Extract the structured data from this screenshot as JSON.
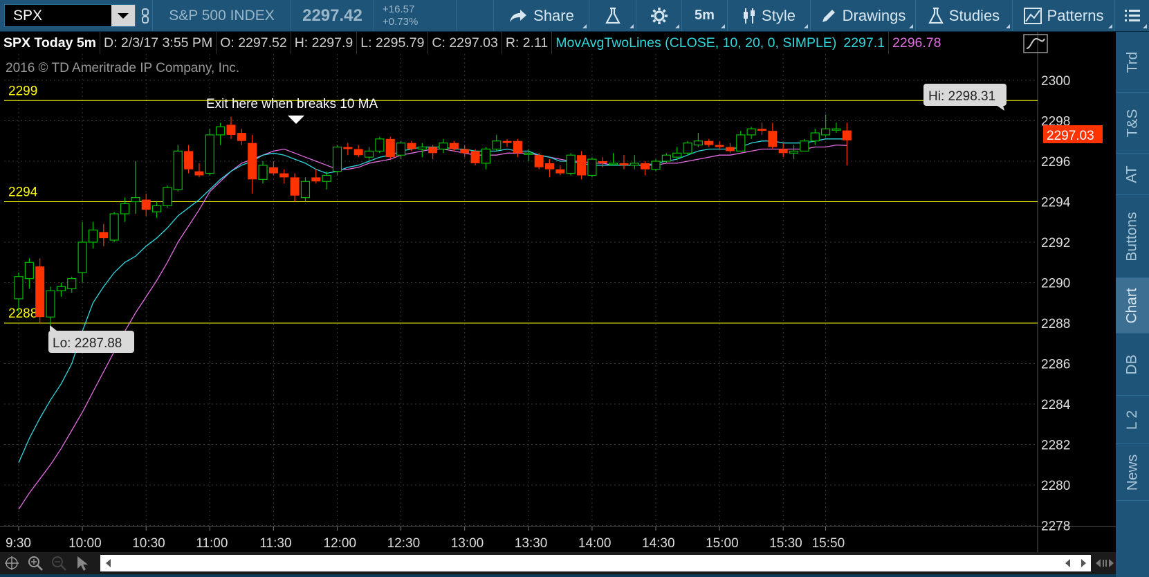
{
  "toolbar": {
    "symbol": "SPX",
    "index_name": "S&P 500 INDEX",
    "last_price": "2297.42",
    "change": "+16.57",
    "change_pct": "+0.73%",
    "share_label": "Share",
    "timeframe": "5m",
    "style_label": "Style",
    "drawings_label": "Drawings",
    "studies_label": "Studies",
    "patterns_label": "Patterns"
  },
  "header": {
    "ticker": "SPX Today 5m",
    "date": "D: 2/3/17 3:55 PM",
    "open": "O: 2297.52",
    "high": "H: 2297.9",
    "low": "L: 2295.79",
    "close": "C: 2297.03",
    "range": "R: 2.11",
    "study": "MovAvgTwoLines (CLOSE, 10, 20, 0, SIMPLE)",
    "ma1_value": "2297.1",
    "ma2_value": "2296.78"
  },
  "copyright": "2016 © TD Ameritrade IP Company, Inc.",
  "annotations": {
    "exit_note": "Exit here when breaks 10 MA",
    "hi_bubble": "Hi: 2298.31",
    "lo_bubble": "Lo: 2287.88",
    "last_price_tag": "2297.03"
  },
  "side_tabs": [
    "Trd",
    "T&S",
    "AT",
    "Buttons",
    "Chart",
    "DB",
    "L 2",
    "News"
  ],
  "active_tab": "Chart",
  "colors": {
    "up_candle": "#00c000",
    "down_candle": "#ff3300",
    "ma_fast": "#2fd8df",
    "ma_slow": "#e36ee3",
    "level_line": "#ffff00",
    "toolbar_bg": "#1e5478"
  },
  "chart_data": {
    "type": "candlestick",
    "interval": "5m",
    "ylim": [
      2278,
      2301
    ],
    "y_ticks": [
      "2300",
      "2298",
      "2296",
      "2294",
      "2292",
      "2290",
      "2288",
      "2286",
      "2284",
      "2282",
      "2280",
      "2278"
    ],
    "x_ticks": [
      "9:30",
      "10:00",
      "10:30",
      "11:00",
      "11:30",
      "12:00",
      "12:30",
      "13:00",
      "13:30",
      "14:00",
      "14:30",
      "15:00",
      "15:30",
      "15:50"
    ],
    "x_tick_minutes": [
      0,
      30,
      60,
      90,
      120,
      150,
      180,
      210,
      240,
      270,
      300,
      330,
      360,
      380
    ],
    "levels": [
      {
        "value": 2299,
        "label": "2299"
      },
      {
        "value": 2294,
        "label": "2294"
      },
      {
        "value": 2288,
        "label": "2288"
      }
    ],
    "candles": [
      [
        0,
        2289.2,
        2290.5,
        2288.5,
        2290.3
      ],
      [
        5,
        2290.2,
        2291.2,
        2289.7,
        2291.0
      ],
      [
        10,
        2290.8,
        2291.2,
        2288.0,
        2288.3
      ],
      [
        15,
        2288.3,
        2289.8,
        2287.88,
        2289.6
      ],
      [
        20,
        2289.6,
        2290.0,
        2289.3,
        2289.8
      ],
      [
        25,
        2289.7,
        2290.3,
        2289.5,
        2290.2
      ],
      [
        30,
        2290.5,
        2293.0,
        2290.0,
        2292.0
      ],
      [
        35,
        2292.0,
        2293.0,
        2291.7,
        2292.6
      ],
      [
        40,
        2292.5,
        2292.9,
        2291.8,
        2292.2
      ],
      [
        45,
        2292.1,
        2293.5,
        2292.0,
        2293.4
      ],
      [
        50,
        2293.4,
        2294.2,
        2293.0,
        2293.9
      ],
      [
        55,
        2294.0,
        2296.0,
        2293.4,
        2294.2
      ],
      [
        60,
        2294.1,
        2294.4,
        2293.3,
        2293.6
      ],
      [
        65,
        2293.5,
        2294.0,
        2293.2,
        2293.8
      ],
      [
        70,
        2293.8,
        2294.8,
        2293.7,
        2294.7
      ],
      [
        75,
        2294.6,
        2296.8,
        2294.5,
        2296.5
      ],
      [
        80,
        2296.5,
        2296.8,
        2295.4,
        2295.6
      ],
      [
        85,
        2295.5,
        2295.9,
        2295.2,
        2295.3
      ],
      [
        90,
        2295.4,
        2297.6,
        2295.3,
        2297.3
      ],
      [
        95,
        2297.3,
        2297.9,
        2296.8,
        2297.7
      ],
      [
        100,
        2297.8,
        2298.2,
        2297.1,
        2297.3
      ],
      [
        105,
        2297.4,
        2297.6,
        2296.8,
        2297.0
      ],
      [
        110,
        2296.9,
        2297.3,
        2294.4,
        2295.1
      ],
      [
        115,
        2295.1,
        2296.0,
        2294.9,
        2295.8
      ],
      [
        120,
        2295.7,
        2296.0,
        2295.3,
        2295.4
      ],
      [
        125,
        2295.4,
        2295.6,
        2294.9,
        2295.2
      ],
      [
        130,
        2295.2,
        2295.4,
        2294.0,
        2294.3
      ],
      [
        135,
        2294.2,
        2295.2,
        2294.0,
        2295.0
      ],
      [
        140,
        2295.2,
        2295.6,
        2294.9,
        2295.0
      ],
      [
        145,
        2295.0,
        2295.5,
        2294.6,
        2295.3
      ],
      [
        150,
        2295.5,
        2296.8,
        2295.3,
        2296.7
      ],
      [
        155,
        2296.7,
        2296.9,
        2296.3,
        2296.6
      ],
      [
        160,
        2296.6,
        2296.8,
        2296.2,
        2296.3
      ],
      [
        165,
        2296.2,
        2296.7,
        2295.9,
        2296.5
      ],
      [
        170,
        2296.5,
        2297.2,
        2296.4,
        2297.1
      ],
      [
        175,
        2297.1,
        2297.2,
        2296.1,
        2296.2
      ],
      [
        180,
        2296.3,
        2297.0,
        2296.1,
        2296.9
      ],
      [
        185,
        2296.9,
        2297.0,
        2296.5,
        2296.6
      ],
      [
        190,
        2296.6,
        2296.9,
        2296.2,
        2296.7
      ],
      [
        195,
        2296.7,
        2296.8,
        2296.1,
        2296.4
      ],
      [
        200,
        2296.6,
        2297.1,
        2296.4,
        2296.9
      ],
      [
        205,
        2296.9,
        2297.0,
        2296.5,
        2296.6
      ],
      [
        210,
        2296.6,
        2296.8,
        2296.2,
        2296.4
      ],
      [
        215,
        2296.5,
        2296.6,
        2295.8,
        2295.9
      ],
      [
        220,
        2295.9,
        2296.7,
        2295.6,
        2296.6
      ],
      [
        225,
        2296.6,
        2297.3,
        2296.5,
        2297.0
      ],
      [
        230,
        2297.0,
        2297.1,
        2296.7,
        2296.9
      ],
      [
        235,
        2297.0,
        2297.1,
        2296.2,
        2296.4
      ],
      [
        240,
        2296.4,
        2296.6,
        2296.0,
        2296.4
      ],
      [
        245,
        2296.3,
        2296.4,
        2295.6,
        2295.7
      ],
      [
        250,
        2295.9,
        2296.1,
        2295.2,
        2295.6
      ],
      [
        255,
        2295.6,
        2295.8,
        2295.3,
        2295.4
      ],
      [
        260,
        2295.4,
        2296.4,
        2295.3,
        2296.3
      ],
      [
        265,
        2296.3,
        2296.5,
        2295.1,
        2295.3
      ],
      [
        270,
        2295.3,
        2296.2,
        2295.2,
        2296.1
      ],
      [
        275,
        2296.0,
        2296.2,
        2295.7,
        2295.9
      ],
      [
        280,
        2295.9,
        2296.4,
        2295.8,
        2295.9
      ],
      [
        285,
        2295.9,
        2296.3,
        2295.6,
        2295.8
      ],
      [
        290,
        2295.8,
        2296.3,
        2295.6,
        2295.9
      ],
      [
        295,
        2295.9,
        2296.0,
        2295.3,
        2295.6
      ],
      [
        300,
        2295.6,
        2296.1,
        2295.5,
        2296.0
      ],
      [
        305,
        2296.0,
        2296.4,
        2295.9,
        2296.3
      ],
      [
        310,
        2296.2,
        2296.7,
        2296.1,
        2296.4
      ],
      [
        315,
        2296.4,
        2297.0,
        2296.3,
        2296.9
      ],
      [
        320,
        2296.8,
        2297.4,
        2296.7,
        2297.0
      ],
      [
        325,
        2297.0,
        2297.1,
        2296.7,
        2296.8
      ],
      [
        330,
        2296.8,
        2297.0,
        2296.6,
        2296.7
      ],
      [
        335,
        2296.7,
        2296.9,
        2296.4,
        2296.5
      ],
      [
        340,
        2296.5,
        2297.5,
        2296.5,
        2297.3
      ],
      [
        345,
        2297.3,
        2297.7,
        2297.1,
        2297.6
      ],
      [
        350,
        2297.6,
        2297.9,
        2297.3,
        2297.5
      ],
      [
        355,
        2297.5,
        2297.9,
        2296.6,
        2296.7
      ],
      [
        360,
        2296.6,
        2296.9,
        2296.2,
        2296.4
      ],
      [
        365,
        2296.4,
        2296.8,
        2296.1,
        2296.5
      ],
      [
        370,
        2296.5,
        2297.1,
        2296.5,
        2297.0
      ],
      [
        375,
        2297.0,
        2297.6,
        2296.8,
        2297.4
      ],
      [
        380,
        2297.3,
        2298.31,
        2297.2,
        2297.6
      ],
      [
        385,
        2297.6,
        2297.9,
        2297.4,
        2297.6
      ],
      [
        390,
        2297.52,
        2297.9,
        2295.79,
        2297.03
      ]
    ],
    "ma_fast": [
      [
        0,
        2281.1
      ],
      [
        5,
        2282.3
      ],
      [
        10,
        2283.3
      ],
      [
        15,
        2284.2
      ],
      [
        20,
        2285.0
      ],
      [
        25,
        2286.0
      ],
      [
        30,
        2287.6
      ],
      [
        35,
        2289.0
      ],
      [
        40,
        2289.8
      ],
      [
        45,
        2290.5
      ],
      [
        50,
        2291.0
      ],
      [
        55,
        2291.3
      ],
      [
        60,
        2291.8
      ],
      [
        65,
        2292.2
      ],
      [
        70,
        2292.7
      ],
      [
        75,
        2293.3
      ],
      [
        80,
        2293.7
      ],
      [
        85,
        2294.1
      ],
      [
        90,
        2294.6
      ],
      [
        95,
        2295.1
      ],
      [
        100,
        2295.5
      ],
      [
        105,
        2295.8
      ],
      [
        110,
        2296.0
      ],
      [
        115,
        2296.3
      ],
      [
        120,
        2296.4
      ],
      [
        125,
        2296.3
      ],
      [
        130,
        2296.1
      ],
      [
        135,
        2295.9
      ],
      [
        140,
        2295.6
      ],
      [
        145,
        2295.4
      ],
      [
        150,
        2295.5
      ],
      [
        155,
        2295.7
      ],
      [
        160,
        2295.8
      ],
      [
        165,
        2296.0
      ],
      [
        170,
        2296.2
      ],
      [
        175,
        2296.3
      ],
      [
        180,
        2296.5
      ],
      [
        185,
        2296.6
      ],
      [
        190,
        2296.7
      ],
      [
        195,
        2296.7
      ],
      [
        200,
        2296.7
      ],
      [
        205,
        2296.6
      ],
      [
        210,
        2296.6
      ],
      [
        215,
        2296.5
      ],
      [
        220,
        2296.5
      ],
      [
        225,
        2296.5
      ],
      [
        230,
        2296.6
      ],
      [
        235,
        2296.5
      ],
      [
        240,
        2296.5
      ],
      [
        245,
        2296.3
      ],
      [
        250,
        2296.2
      ],
      [
        255,
        2296.0
      ],
      [
        260,
        2296.0
      ],
      [
        265,
        2295.9
      ],
      [
        270,
        2295.8
      ],
      [
        275,
        2295.8
      ],
      [
        280,
        2295.8
      ],
      [
        285,
        2295.8
      ],
      [
        290,
        2295.8
      ],
      [
        295,
        2295.8
      ],
      [
        300,
        2295.9
      ],
      [
        305,
        2296.0
      ],
      [
        310,
        2296.1
      ],
      [
        315,
        2296.3
      ],
      [
        320,
        2296.5
      ],
      [
        325,
        2296.6
      ],
      [
        330,
        2296.6
      ],
      [
        335,
        2296.6
      ],
      [
        340,
        2296.7
      ],
      [
        345,
        2296.9
      ],
      [
        350,
        2297.0
      ],
      [
        355,
        2297.0
      ],
      [
        360,
        2296.9
      ],
      [
        365,
        2296.9
      ],
      [
        370,
        2296.9
      ],
      [
        375,
        2297.0
      ],
      [
        380,
        2297.1
      ],
      [
        385,
        2297.1
      ],
      [
        390,
        2297.1
      ]
    ],
    "ma_slow": [
      [
        0,
        2278.8
      ],
      [
        5,
        2279.6
      ],
      [
        10,
        2280.3
      ],
      [
        15,
        2281.0
      ],
      [
        20,
        2281.8
      ],
      [
        25,
        2282.7
      ],
      [
        30,
        2283.6
      ],
      [
        35,
        2284.6
      ],
      [
        40,
        2285.6
      ],
      [
        45,
        2286.6
      ],
      [
        50,
        2287.6
      ],
      [
        55,
        2288.5
      ],
      [
        60,
        2289.3
      ],
      [
        65,
        2290.1
      ],
      [
        70,
        2291.0
      ],
      [
        75,
        2292.0
      ],
      [
        80,
        2292.8
      ],
      [
        85,
        2293.6
      ],
      [
        90,
        2294.5
      ],
      [
        95,
        2295.0
      ],
      [
        100,
        2295.5
      ],
      [
        105,
        2295.9
      ],
      [
        110,
        2296.1
      ],
      [
        115,
        2296.3
      ],
      [
        120,
        2296.5
      ],
      [
        125,
        2296.6
      ],
      [
        130,
        2296.4
      ],
      [
        135,
        2296.2
      ],
      [
        140,
        2296.0
      ],
      [
        145,
        2295.8
      ],
      [
        150,
        2295.6
      ],
      [
        155,
        2295.6
      ],
      [
        160,
        2295.7
      ],
      [
        165,
        2295.9
      ],
      [
        170,
        2296.0
      ],
      [
        175,
        2296.1
      ],
      [
        180,
        2296.3
      ],
      [
        185,
        2296.4
      ],
      [
        190,
        2296.5
      ],
      [
        195,
        2296.6
      ],
      [
        200,
        2296.6
      ],
      [
        205,
        2296.5
      ],
      [
        210,
        2296.4
      ],
      [
        215,
        2296.3
      ],
      [
        220,
        2296.3
      ],
      [
        225,
        2296.3
      ],
      [
        230,
        2296.4
      ],
      [
        235,
        2296.4
      ],
      [
        240,
        2296.4
      ],
      [
        245,
        2296.3
      ],
      [
        250,
        2296.2
      ],
      [
        255,
        2296.1
      ],
      [
        260,
        2296.0
      ],
      [
        265,
        2296.0
      ],
      [
        270,
        2295.9
      ],
      [
        275,
        2295.9
      ],
      [
        280,
        2295.8
      ],
      [
        285,
        2295.8
      ],
      [
        290,
        2295.8
      ],
      [
        295,
        2295.8
      ],
      [
        300,
        2295.8
      ],
      [
        305,
        2295.9
      ],
      [
        310,
        2295.9
      ],
      [
        315,
        2296.0
      ],
      [
        320,
        2296.1
      ],
      [
        325,
        2296.2
      ],
      [
        330,
        2296.3
      ],
      [
        335,
        2296.3
      ],
      [
        340,
        2296.4
      ],
      [
        345,
        2296.5
      ],
      [
        350,
        2296.6
      ],
      [
        355,
        2296.6
      ],
      [
        360,
        2296.6
      ],
      [
        365,
        2296.6
      ],
      [
        370,
        2296.6
      ],
      [
        375,
        2296.7
      ],
      [
        380,
        2296.7
      ],
      [
        385,
        2296.8
      ],
      [
        390,
        2296.78
      ]
    ]
  }
}
